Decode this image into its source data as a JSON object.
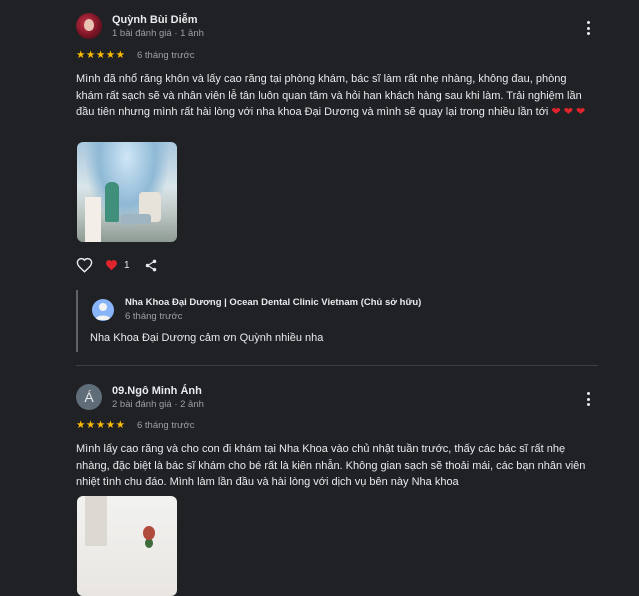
{
  "reviews": [
    {
      "author": "Quỳnh Bùi Diễm",
      "author_meta": "1 bài đánh giá · 1 ảnh",
      "rating_stars": "★★★★★",
      "rating": 5,
      "time": "6 tháng trước",
      "text": "Mình đã nhổ răng khôn và lấy cao răng tại phòng khám, bác sĩ làm rất nhẹ nhàng, không đau, phòng khám rất sạch sẽ và nhân viên lễ tân luôn quan tâm và hỏi han khách hàng sau khi làm. Trải nghiệm lần đầu tiên nhưng mình rất hài lòng với nha khoa Đại Dương và mình sẽ quay lại trong nhiều lần tới",
      "text_hearts": "❤ ❤ ❤",
      "likes": "1",
      "owner_reply": {
        "owner_name": "Nha Khoa Đại Dương | Ocean Dental Clinic Vietnam (Chủ sở hữu)",
        "time": "6 tháng trước",
        "text": "Nha Khoa Đại Dương cảm ơn Quỳnh nhiều nha"
      }
    },
    {
      "author_initial": "Á",
      "author": "09.Ngô Minh Ánh",
      "author_meta": "2 bài đánh giá · 2 ảnh",
      "rating_stars": "★★★★★",
      "rating": 5,
      "time": "6 tháng trước",
      "text": "Mình lấy cao răng và cho con đi khám tại Nha Khoa vào chủ nhật tuần trước, thấy các bác sĩ rất nhẹ nhàng, đặc biệt là bác sĩ khám cho bé rất là kiên nhẫn. Không gian sạch sẽ thoải mái, các bạn nhân viên nhiệt tình chu đáo. Mình làm lần đầu và hài lòng với dịch vụ bên này Nha khoa"
    }
  ],
  "icons": {
    "more": "more-vert-icon",
    "like": "heart-outline-icon",
    "reaction": "heart-filled-icon",
    "share": "share-icon"
  },
  "colors": {
    "background": "#202124",
    "star": "#fbbc04",
    "heart": "#e0242e",
    "owner_avatar": "#8ab4f8"
  }
}
